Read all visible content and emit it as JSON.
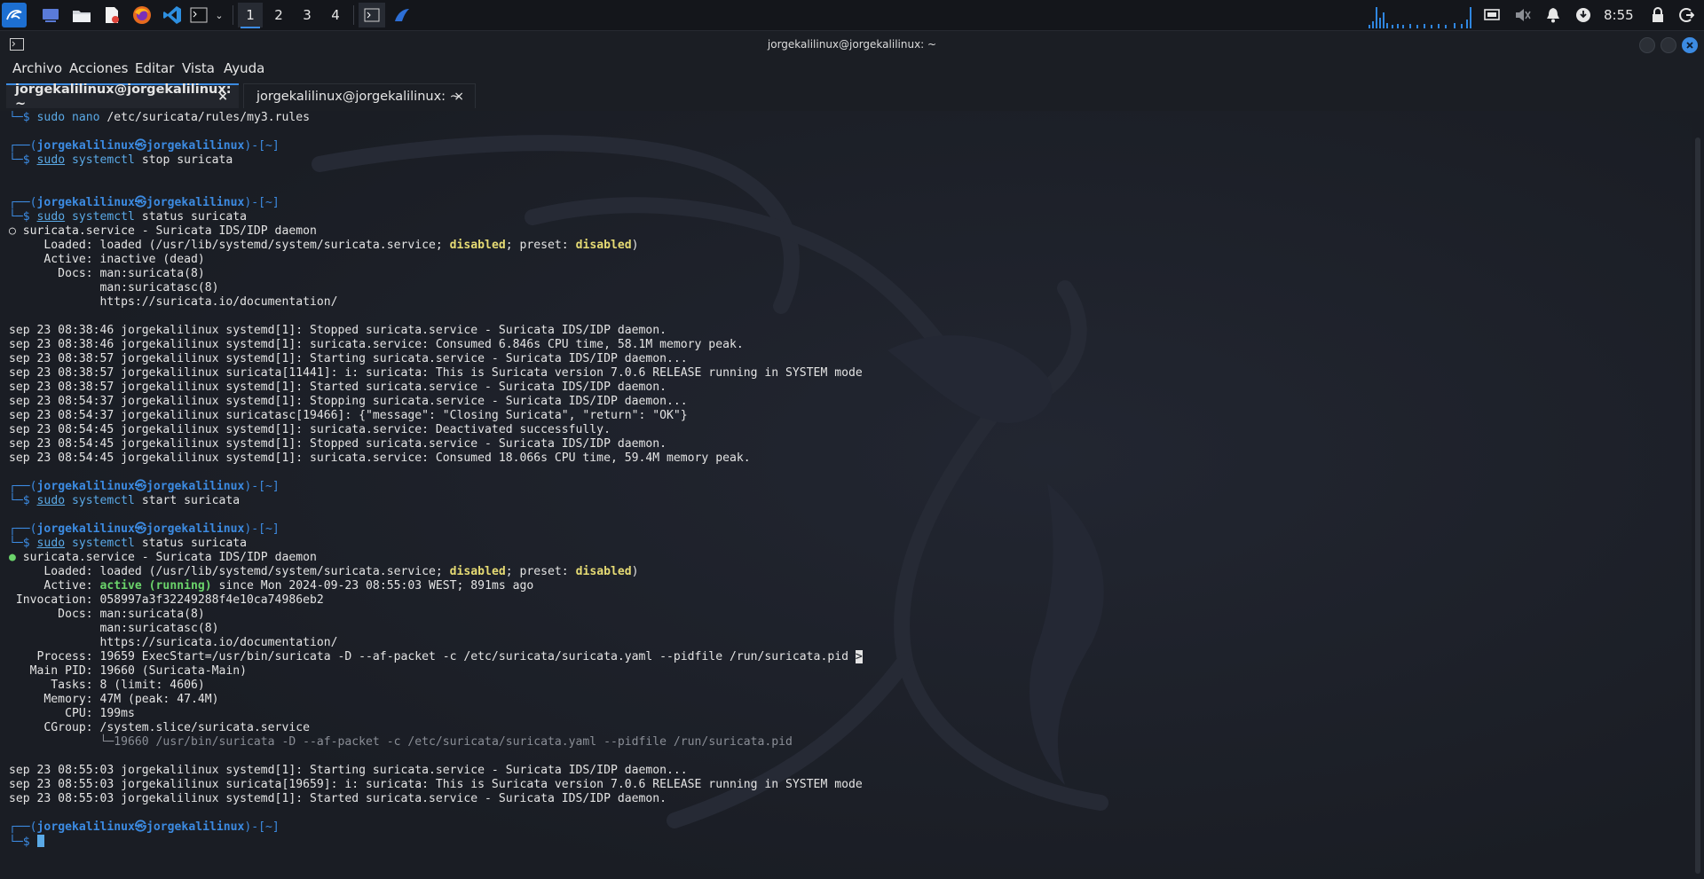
{
  "panel": {
    "workspaces": [
      "1",
      "2",
      "3",
      "4"
    ],
    "active_workspace": "1",
    "clock": "8:55",
    "launchers": [
      "kali-menu-icon",
      "desktop-icon",
      "file-manager-icon",
      "text-editor-icon",
      "firefox-icon",
      "vscode-icon",
      "terminal-icon",
      "dropdown-chevron-icon"
    ]
  },
  "window": {
    "title": "jorgekalilinux@jorgekalilinux: ~",
    "menu": [
      "Archivo",
      "Acciones",
      "Editar",
      "Vista",
      "Ayuda"
    ],
    "tabs": [
      {
        "label": "jorgekalilinux@jorgekalilinux: ~",
        "active": true
      },
      {
        "label": "jorgekalilinux@jorgekalilinux: ~",
        "active": false
      }
    ],
    "tab_close": "×"
  },
  "prompt": {
    "open": "┌──(",
    "user": "jorgekalilinux",
    "at": "㉿",
    "host": "jorgekalilinux",
    "dir_part": ")-[~]",
    "cont": "└─$"
  },
  "terminal": {
    "lines": [
      {
        "t": "cmd",
        "cmd": "sudo",
        "args": " nano /etc/suricata/rules/my3.rules",
        "underline": false,
        "bin": "nano"
      },
      {
        "t": "blank"
      },
      {
        "t": "prompt"
      },
      {
        "t": "cmd",
        "cmd": "sudo",
        "bin": "systemctl",
        "rest": " stop suricata"
      },
      {
        "t": "blank"
      },
      {
        "t": "blank"
      },
      {
        "t": "prompt"
      },
      {
        "t": "cmd",
        "cmd": "sudo",
        "bin": "systemctl",
        "rest": " status suricata"
      },
      {
        "t": "text",
        "text": "○ suricata.service - Suricata IDS/IDP daemon"
      },
      {
        "t": "loaded",
        "pre": "     Loaded: loaded (/usr/lib/systemd/system/suricata.service; ",
        "w1": "disabled",
        "mid": "; preset: ",
        "w2": "disabled",
        "post": ")"
      },
      {
        "t": "text",
        "text": "     Active: inactive (dead)"
      },
      {
        "t": "text",
        "text": "       Docs: man:suricata(8)"
      },
      {
        "t": "text",
        "text": "             man:suricatasc(8)"
      },
      {
        "t": "text",
        "text": "             https://suricata.io/documentation/"
      },
      {
        "t": "blank"
      },
      {
        "t": "text",
        "text": "sep 23 08:38:46 jorgekalilinux systemd[1]: Stopped suricata.service - Suricata IDS/IDP daemon."
      },
      {
        "t": "text",
        "text": "sep 23 08:38:46 jorgekalilinux systemd[1]: suricata.service: Consumed 6.846s CPU time, 58.1M memory peak."
      },
      {
        "t": "text",
        "text": "sep 23 08:38:57 jorgekalilinux systemd[1]: Starting suricata.service - Suricata IDS/IDP daemon..."
      },
      {
        "t": "text",
        "text": "sep 23 08:38:57 jorgekalilinux suricata[11441]: i: suricata: This is Suricata version 7.0.6 RELEASE running in SYSTEM mode"
      },
      {
        "t": "text",
        "text": "sep 23 08:38:57 jorgekalilinux systemd[1]: Started suricata.service - Suricata IDS/IDP daemon."
      },
      {
        "t": "text",
        "text": "sep 23 08:54:37 jorgekalilinux systemd[1]: Stopping suricata.service - Suricata IDS/IDP daemon..."
      },
      {
        "t": "text",
        "text": "sep 23 08:54:37 jorgekalilinux suricatasc[19466]: {\"message\": \"Closing Suricata\", \"return\": \"OK\"}"
      },
      {
        "t": "text",
        "text": "sep 23 08:54:45 jorgekalilinux systemd[1]: suricata.service: Deactivated successfully."
      },
      {
        "t": "text",
        "text": "sep 23 08:54:45 jorgekalilinux systemd[1]: Stopped suricata.service - Suricata IDS/IDP daemon."
      },
      {
        "t": "text",
        "text": "sep 23 08:54:45 jorgekalilinux systemd[1]: suricata.service: Consumed 18.066s CPU time, 59.4M memory peak."
      },
      {
        "t": "blank"
      },
      {
        "t": "prompt"
      },
      {
        "t": "cmd",
        "cmd": "sudo",
        "bin": "systemctl",
        "rest": " start suricata"
      },
      {
        "t": "blank"
      },
      {
        "t": "prompt"
      },
      {
        "t": "cmd",
        "cmd": "sudo",
        "bin": "systemctl",
        "rest": " status suricata"
      },
      {
        "t": "dot",
        "dot": "●",
        "text": " suricata.service - Suricata IDS/IDP daemon"
      },
      {
        "t": "loaded",
        "pre": "     Loaded: loaded (/usr/lib/systemd/system/suricata.service; ",
        "w1": "disabled",
        "mid": "; preset: ",
        "w2": "disabled",
        "post": ")"
      },
      {
        "t": "active",
        "pre": "     Active: ",
        "state": "active (running)",
        "post": " since Mon 2024-09-23 08:55:03 WEST; 891ms ago"
      },
      {
        "t": "text",
        "text": " Invocation: 058997a3f32249288f4e10ca74986eb2"
      },
      {
        "t": "text",
        "text": "       Docs: man:suricata(8)"
      },
      {
        "t": "text",
        "text": "             man:suricatasc(8)"
      },
      {
        "t": "text",
        "text": "             https://suricata.io/documentation/"
      },
      {
        "t": "process",
        "text": "    Process: 19659 ExecStart=/usr/bin/suricata -D --af-packet -c /etc/suricata/suricata.yaml --pidfile /run/suricata.pid ",
        "gt": ">"
      },
      {
        "t": "text",
        "text": "   Main PID: 19660 (Suricata-Main)"
      },
      {
        "t": "text",
        "text": "      Tasks: 8 (limit: 4606)"
      },
      {
        "t": "text",
        "text": "     Memory: 47M (peak: 47.4M)"
      },
      {
        "t": "text",
        "text": "        CPU: 199ms"
      },
      {
        "t": "text",
        "text": "     CGroup: /system.slice/suricata.service"
      },
      {
        "t": "dimline",
        "pre": "             ",
        "text": "└─19660 /usr/bin/suricata -D --af-packet -c /etc/suricata/suricata.yaml --pidfile /run/suricata.pid"
      },
      {
        "t": "blank"
      },
      {
        "t": "text",
        "text": "sep 23 08:55:03 jorgekalilinux systemd[1]: Starting suricata.service - Suricata IDS/IDP daemon..."
      },
      {
        "t": "text",
        "text": "sep 23 08:55:03 jorgekalilinux suricata[19659]: i: suricata: This is Suricata version 7.0.6 RELEASE running in SYSTEM mode"
      },
      {
        "t": "text",
        "text": "sep 23 08:55:03 jorgekalilinux systemd[1]: Started suricata.service - Suricata IDS/IDP daemon."
      },
      {
        "t": "blank"
      },
      {
        "t": "prompt"
      },
      {
        "t": "current"
      }
    ]
  },
  "colors": {
    "accent": "#3c8be2",
    "warning": "#e6db74",
    "success": "#6bd46b"
  }
}
